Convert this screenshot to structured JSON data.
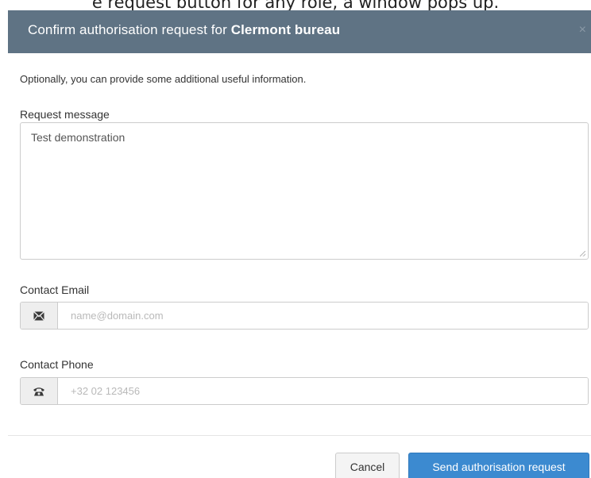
{
  "caption": "e request button for any role, a window pops up.",
  "dialog": {
    "title_prefix": "Confirm authorisation request for ",
    "title_entity": "Clermont bureau",
    "close_glyph": "×",
    "intro": "Optionally, you can provide some additional useful information.",
    "request_message": {
      "label": "Request message",
      "value": "Test demonstration"
    },
    "contact_email": {
      "label": "Contact Email",
      "placeholder": "name@domain.com",
      "icon": "envelope-icon"
    },
    "contact_phone": {
      "label": "Contact Phone",
      "placeholder": "+32 02 123456",
      "icon": "phone-icon"
    },
    "buttons": {
      "cancel": "Cancel",
      "send": "Send authorisation request"
    }
  },
  "colors": {
    "header_bg": "#5f7384",
    "primary_button": "#3c8ad0"
  }
}
